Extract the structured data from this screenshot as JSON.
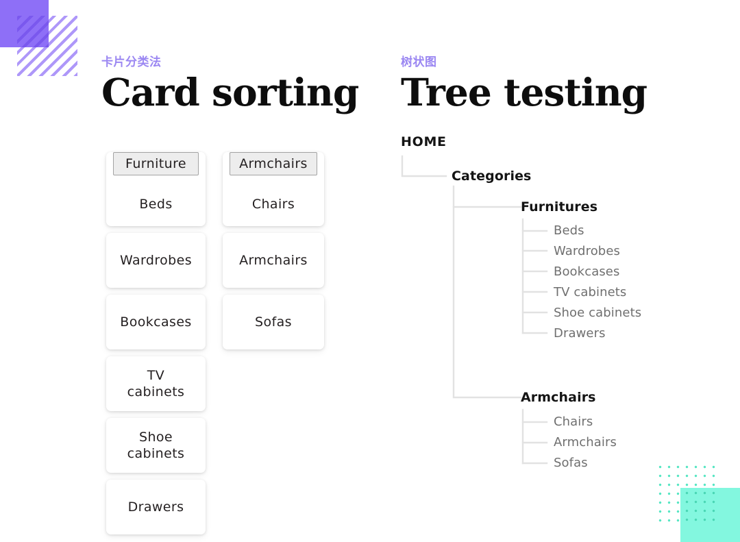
{
  "slide": {
    "background_color": "#ffffff",
    "accent_purple": "#8E6FF7",
    "accent_purple_text": "#9B87F2",
    "accent_mint": "#83F7DF",
    "leaf_text_color": "#6f6f6f"
  },
  "left_panel": {
    "kicker": "卡片分类法",
    "headline": "Card sorting",
    "columns": [
      {
        "group_label": "Furniture",
        "cards": [
          "Beds",
          "Wardrobes",
          "Bookcases",
          "TV\ncabinets",
          "Shoe\ncabinets",
          "Drawers"
        ]
      },
      {
        "group_label": "Armchairs",
        "cards": [
          "Chairs",
          "Armchairs",
          "Sofas"
        ]
      }
    ]
  },
  "right_panel": {
    "kicker": "树状图",
    "headline": "Tree testing",
    "tree": {
      "root": "HOME",
      "level1": "Categories",
      "branches": [
        {
          "label": "Furnitures",
          "leaves": [
            "Beds",
            "Wardrobes",
            "Bookcases",
            "TV cabinets",
            "Shoe cabinets",
            "Drawers"
          ]
        },
        {
          "label": "Armchairs",
          "leaves": [
            "Chairs",
            "Armchairs",
            "Sofas"
          ]
        }
      ]
    }
  },
  "decorations": {
    "top_left": "purple-square-with-diagonal-hatch",
    "bottom_right": "mint-square-with-dot-grid"
  }
}
